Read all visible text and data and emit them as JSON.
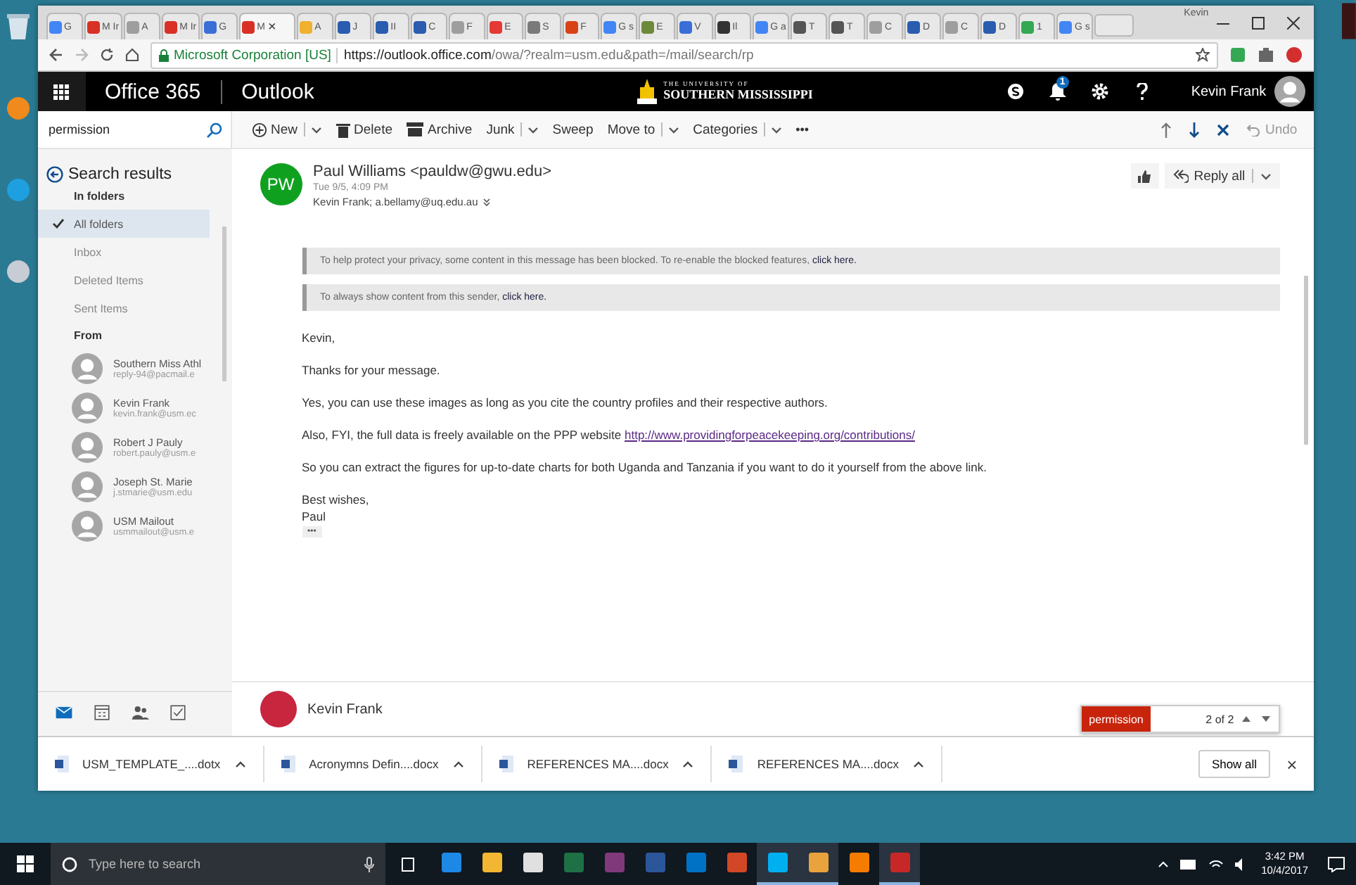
{
  "browser": {
    "tabs": [
      {
        "label": "G",
        "color": "#4285f4",
        "selected": false
      },
      {
        "label": "M Ir",
        "color": "#d93025",
        "selected": false
      },
      {
        "label": "A",
        "color": "#9e9e9e",
        "selected": false
      },
      {
        "label": "M Ir",
        "color": "#d93025",
        "selected": false
      },
      {
        "label": "G",
        "color": "#3b6fd8",
        "selected": false
      },
      {
        "label": "M",
        "color": "#d93025",
        "selected": true
      },
      {
        "label": "A",
        "color": "#f0b030",
        "selected": false
      },
      {
        "label": "J",
        "color": "#2a5cb0",
        "selected": false
      },
      {
        "label": "II",
        "color": "#2a5cb0",
        "selected": false
      },
      {
        "label": "C",
        "color": "#2a5cb0",
        "selected": false
      },
      {
        "label": "F",
        "color": "#9e9e9e",
        "selected": false
      },
      {
        "label": "E",
        "color": "#e53935",
        "selected": false
      },
      {
        "label": "S",
        "color": "#7a7a7a",
        "selected": false
      },
      {
        "label": "F",
        "color": "#d84315",
        "selected": false
      },
      {
        "label": "G s",
        "color": "#4285f4",
        "selected": false
      },
      {
        "label": "E",
        "color": "#6d8a3a",
        "selected": false
      },
      {
        "label": "V",
        "color": "#3b6fd8",
        "selected": false
      },
      {
        "label": "Il",
        "color": "#333333",
        "selected": false
      },
      {
        "label": "G a",
        "color": "#4285f4",
        "selected": false
      },
      {
        "label": "T",
        "color": "#555555",
        "selected": false
      },
      {
        "label": "T",
        "color": "#555555",
        "selected": false
      },
      {
        "label": "C",
        "color": "#9e9e9e",
        "selected": false
      },
      {
        "label": "D",
        "color": "#2a5cb0",
        "selected": false
      },
      {
        "label": "C",
        "color": "#9e9e9e",
        "selected": false
      },
      {
        "label": "D",
        "color": "#2a5cb0",
        "selected": false
      },
      {
        "label": "1",
        "color": "#34a853",
        "selected": false
      },
      {
        "label": "G s",
        "color": "#4285f4",
        "selected": false
      }
    ],
    "tab_close": "×",
    "profile": "Kevin",
    "security_label": "Microsoft Corporation [US]",
    "url_host": "https://outlook.office.com",
    "url_path": "/owa/?realm=usm.edu&path=/mail/search/rp"
  },
  "header": {
    "suite": "Office 365",
    "app": "Outlook",
    "logo_small": "THE UNIVERSITY OF",
    "logo_large": "SOUTHERN MISSISSIPPI",
    "notifications": "1",
    "user": "Kevin Frank"
  },
  "toolbar": {
    "search": {
      "value": "permission"
    },
    "actions": [
      {
        "label": "New",
        "kind": "new",
        "dropdown": true
      },
      {
        "label": "Delete",
        "kind": "delete",
        "dropdown": false
      },
      {
        "label": "Archive",
        "kind": "archive",
        "dropdown": false
      },
      {
        "label": "Junk",
        "kind": "plain",
        "dropdown": true
      },
      {
        "label": "Sweep",
        "kind": "plain",
        "dropdown": false
      },
      {
        "label": "Move to",
        "kind": "plain",
        "dropdown": true
      },
      {
        "label": "Categories",
        "kind": "plain",
        "dropdown": true
      }
    ],
    "more": "•••",
    "undo": "Undo"
  },
  "sidebar": {
    "title": "Search results",
    "folders_heading": "In folders",
    "folders": [
      {
        "label": "All folders",
        "selected": true
      },
      {
        "label": "Inbox",
        "selected": false
      },
      {
        "label": "Deleted Items",
        "selected": false
      },
      {
        "label": "Sent Items",
        "selected": false
      }
    ],
    "from_heading": "From",
    "senders": [
      {
        "name": "Southern Miss Athl",
        "email": "reply-94@pacmail.e"
      },
      {
        "name": "Kevin Frank",
        "email": "kevin.frank@usm.ec"
      },
      {
        "name": "Robert J Pauly",
        "email": "robert.pauly@usm.e"
      },
      {
        "name": "Joseph St. Marie",
        "email": "j.stmarie@usm.edu"
      },
      {
        "name": "USM Mailout",
        "email": "usmmailout@usm.e"
      }
    ],
    "nav": [
      {
        "kind": "mail",
        "selected": true
      },
      {
        "kind": "calendar",
        "selected": false
      },
      {
        "kind": "people",
        "selected": false
      },
      {
        "kind": "tasks",
        "selected": false
      }
    ]
  },
  "message": {
    "initials": "PW",
    "sender": "Paul Williams <pauldw@gwu.edu>",
    "date": "Tue 9/5, 4:09 PM",
    "recipients": "Kevin Frank; a.bellamy@uq.edu.au",
    "reply": "Reply all",
    "notices": [
      {
        "text": "To help protect your privacy, some content in this message has been blocked. To re-enable the blocked features,",
        "link": "click here."
      },
      {
        "text": "To always show content from this sender,",
        "link": "click here."
      }
    ],
    "paragraphs": [
      {
        "text": "Kevin,"
      },
      {
        "text": "Thanks for your message."
      },
      {
        "text": "Yes, you can use these images as long as you cite the country profiles and their respective authors."
      },
      {
        "text": "Also, FYI, the full data is freely available on the PPP website",
        "link": "http://www.providingforpeacekeeping.org/contributions/"
      },
      {
        "text": "So you can extract the figures for up-to-date charts for both Uganda and Tanzania if you want to do it yourself from the above link."
      }
    ],
    "closing": "Best wishes,",
    "signature": "Paul",
    "trimmed": "•••"
  },
  "next_message": {
    "sender": "Kevin Frank"
  },
  "find_bar": {
    "query": "permission",
    "count": "2 of 2"
  },
  "downloads": {
    "files": [
      {
        "name": "USM_TEMPLATE_....dotx"
      },
      {
        "name": "Acronymns Defin....docx"
      },
      {
        "name": "REFERENCES MA....docx"
      },
      {
        "name": "REFERENCES MA....docx"
      }
    ],
    "show_all": "Show all",
    "close": "×"
  },
  "taskbar": {
    "search_placeholder": "Type here to search",
    "time": "3:42 PM",
    "date": "10/4/2017",
    "apps": [
      {
        "color": "#1e88e5",
        "running": false
      },
      {
        "color": "#f2b632",
        "running": false
      },
      {
        "color": "#e0e0e0",
        "running": false
      },
      {
        "color": "#1e7145",
        "running": false
      },
      {
        "color": "#80397b",
        "running": false
      },
      {
        "color": "#2b579a",
        "running": false
      },
      {
        "color": "#0072c6",
        "running": false
      },
      {
        "color": "#d24726",
        "running": false
      },
      {
        "color": "#00aff0",
        "running": true
      },
      {
        "color": "#e8a33d",
        "running": true
      },
      {
        "color": "#f57c00",
        "running": false
      },
      {
        "color": "#c62828",
        "running": true
      }
    ]
  }
}
